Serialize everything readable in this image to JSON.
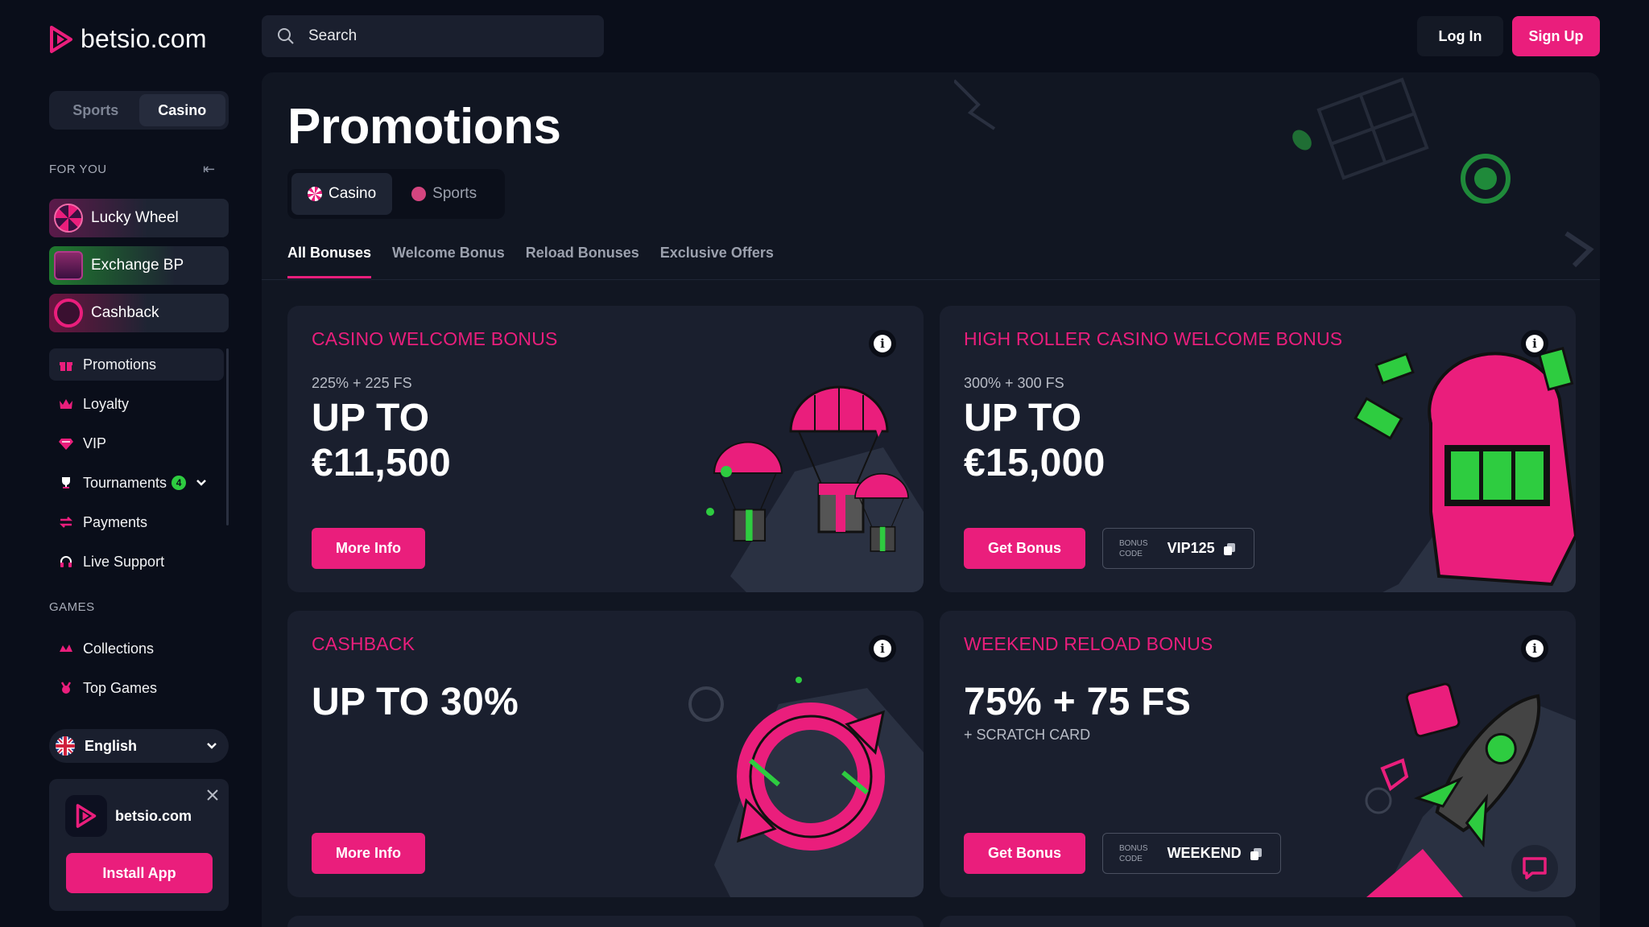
{
  "brand": {
    "name": "betsio.com",
    "accent": "#ea1e7c"
  },
  "sidebar": {
    "mode_tabs": [
      {
        "label": "Sports"
      },
      {
        "label": "Casino"
      }
    ],
    "for_you_label": "FOR YOU",
    "featured": [
      {
        "label": "Lucky Wheel",
        "icon": "lucky-wheel-icon"
      },
      {
        "label": "Exchange BP",
        "icon": "gift-box-icon"
      },
      {
        "label": "Cashback",
        "icon": "cashback-icon"
      }
    ],
    "menu": [
      {
        "label": "Promotions",
        "icon": "gift-icon"
      },
      {
        "label": "Loyalty",
        "icon": "crown-icon"
      },
      {
        "label": "VIP",
        "icon": "diamond-icon"
      },
      {
        "label": "Tournaments",
        "icon": "trophy-icon",
        "badge": "4"
      },
      {
        "label": "Payments",
        "icon": "arrows-icon"
      },
      {
        "label": "Live Support",
        "icon": "headset-icon"
      }
    ],
    "games_label": "GAMES",
    "games": [
      {
        "label": "Collections",
        "icon": "collections-icon"
      },
      {
        "label": "Top Games",
        "icon": "top-games-icon"
      }
    ],
    "language": "English",
    "app_card": {
      "name": "betsio.com",
      "install_label": "Install App"
    }
  },
  "header": {
    "search_placeholder": "Search",
    "login_label": "Log In",
    "signup_label": "Sign Up"
  },
  "main": {
    "title": "Promotions",
    "product_tabs": [
      {
        "label": "Casino"
      },
      {
        "label": "Sports"
      }
    ],
    "sub_tabs": [
      "All Bonuses",
      "Welcome Bonus",
      "Reload Bonuses",
      "Exclusive Offers"
    ],
    "cards": [
      {
        "title": "CASINO WELCOME BONUS",
        "subtitle": "225% + 225 FS",
        "amount_line1": "UP TO",
        "amount_line2": "€11,500",
        "button": "More Info"
      },
      {
        "title": "HIGH ROLLER CASINO WELCOME BONUS",
        "subtitle": "300% + 300 FS",
        "amount_line1": "UP TO",
        "amount_line2": "€15,000",
        "button": "Get Bonus",
        "code_label_1": "BONUS",
        "code_label_2": "CODE",
        "code": "VIP125"
      },
      {
        "title": "CASHBACK",
        "headline": "UP TO 30%",
        "button": "More Info"
      },
      {
        "title": "WEEKEND RELOAD BONUS",
        "headline": "75% + 75 FS",
        "extra": "+ SCRATCH CARD",
        "button": "Get Bonus",
        "code_label_1": "BONUS",
        "code_label_2": "CODE",
        "code": "WEEKEND"
      }
    ]
  }
}
